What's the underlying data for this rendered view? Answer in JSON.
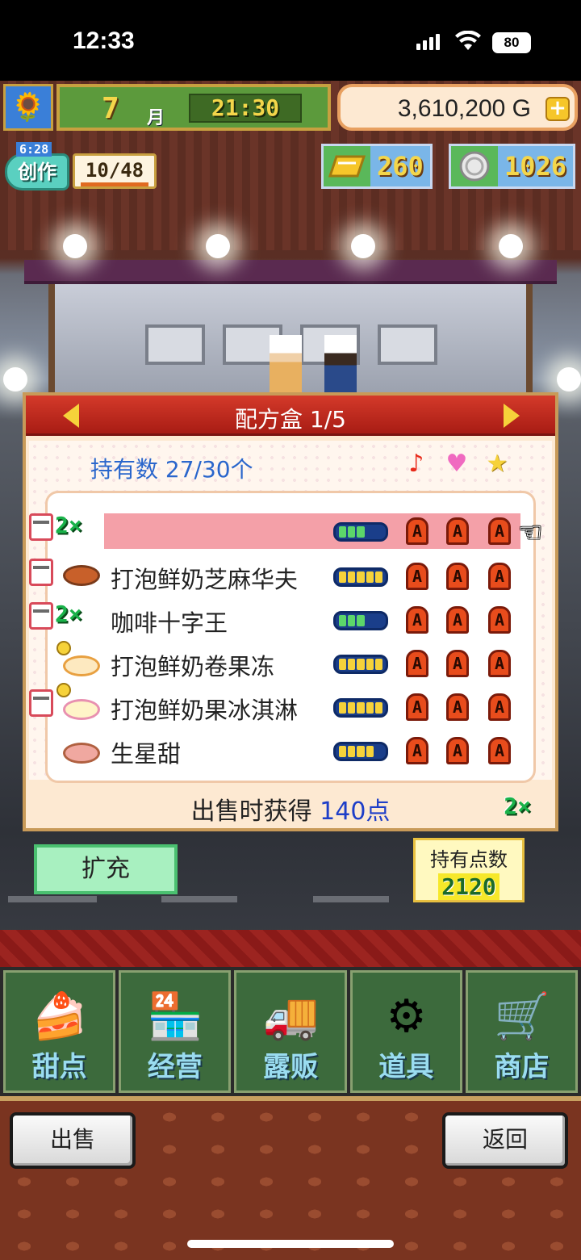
{
  "status_bar": {
    "time": "12:33",
    "battery": "80"
  },
  "hud": {
    "month_number": "7",
    "month_unit": "月",
    "clock": "21:30",
    "money": "3,610,200 G",
    "add_money_label": "+",
    "create_timer": "6:28",
    "create_label": "创作",
    "create_count": "10/48",
    "gold_bars": "260",
    "silver_coins": "1026"
  },
  "dialog": {
    "title": "配方盒 1/5",
    "owned": "持有数 27/30个",
    "recipes": [
      {
        "name": "",
        "gauge": 3,
        "gauge_color": "green",
        "x2": true,
        "jar": true,
        "ranks": [
          "A",
          "A",
          "A"
        ]
      },
      {
        "name": "打泡鲜奶芝麻华夫",
        "gauge": 5,
        "gauge_color": "yellow",
        "x2": false,
        "jar": true,
        "ranks": [
          "A",
          "A",
          "A"
        ]
      },
      {
        "name": "咖啡十字王",
        "gauge": 3,
        "gauge_color": "green",
        "x2": true,
        "jar": true,
        "ranks": [
          "A",
          "A",
          "A"
        ]
      },
      {
        "name": "打泡鲜奶卷果冻",
        "gauge": 5,
        "gauge_color": "yellow",
        "x2": false,
        "jar": false,
        "ranks": [
          "A",
          "A",
          "A"
        ]
      },
      {
        "name": "打泡鲜奶果冰淇淋",
        "gauge": 5,
        "gauge_color": "yellow",
        "x2": false,
        "jar": true,
        "ranks": [
          "A",
          "A",
          "A"
        ]
      },
      {
        "name": "生星甜",
        "gauge": 4,
        "gauge_color": "yellow",
        "x2": false,
        "jar": false,
        "ranks": [
          "A",
          "A",
          "A"
        ]
      }
    ],
    "x2_label": "2×",
    "sale_prefix": "出售时获得 ",
    "sale_points": "140点"
  },
  "expand_button": "扩充",
  "points": {
    "label": "持有点数",
    "value": "2120"
  },
  "menu": [
    "甜点",
    "经营",
    "露贩",
    "道具",
    "商店"
  ],
  "sell_button": "出售",
  "back_button": "返回"
}
